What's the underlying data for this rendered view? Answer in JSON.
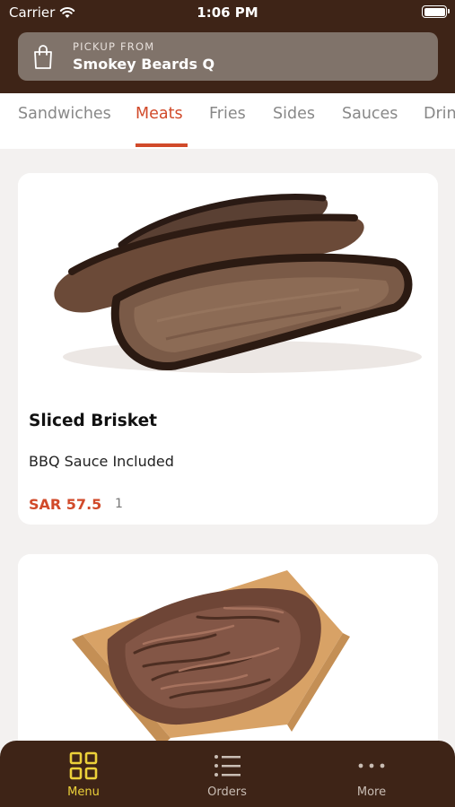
{
  "status_bar": {
    "carrier": "Carrier",
    "time": "1:06 PM"
  },
  "pickup": {
    "label": "PICKUP FROM",
    "store_name": "Smokey Beards Q",
    "icon": "shopping-bag-icon"
  },
  "tabs": [
    {
      "label": "Sandwiches",
      "active": false
    },
    {
      "label": "Meats",
      "active": true
    },
    {
      "label": "Fries",
      "active": false
    },
    {
      "label": "Sides",
      "active": false
    },
    {
      "label": "Sauces",
      "active": false
    },
    {
      "label": "Drinks",
      "active": false
    }
  ],
  "products": [
    {
      "name": "Sliced Brisket",
      "description": "BBQ Sauce Included",
      "price": "SAR 57.5",
      "quantity": "1"
    },
    {
      "name": "",
      "description": "",
      "price": "",
      "quantity": ""
    }
  ],
  "bottom_nav": [
    {
      "label": "Menu",
      "icon": "grid-icon",
      "active": true
    },
    {
      "label": "Orders",
      "icon": "list-icon",
      "active": false
    },
    {
      "label": "More",
      "icon": "more-dots-icon",
      "active": false
    }
  ],
  "colors": {
    "brand_brown": "#3e2417",
    "accent_red": "#d14a2a",
    "active_yellow": "#ecd13a"
  }
}
